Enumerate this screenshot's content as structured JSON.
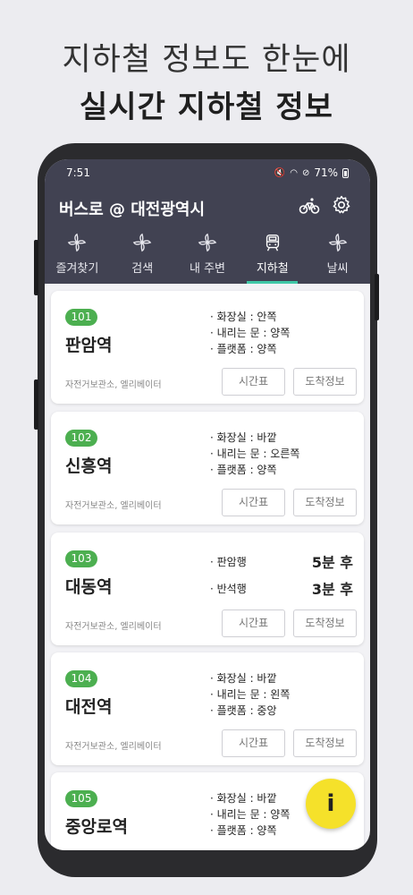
{
  "promo": {
    "line1": "지하철 정보도 한눈에",
    "line2": "실시간 지하철 정보"
  },
  "status_bar": {
    "time": "7:51",
    "battery": "71%"
  },
  "app": {
    "title": "버스로 @ 대전광역시"
  },
  "tabs": [
    {
      "label": "즐겨찾기",
      "icon": "pinwheel-icon"
    },
    {
      "label": "검색",
      "icon": "pinwheel-icon"
    },
    {
      "label": "내 주변",
      "icon": "pinwheel-icon"
    },
    {
      "label": "지하철",
      "icon": "train-icon",
      "active": true
    },
    {
      "label": "날씨",
      "icon": "pinwheel-icon"
    }
  ],
  "colors": {
    "header": "#414252",
    "active_tab_indicator": "#3fc7a6",
    "line_badge": "#4caf50",
    "fab": "#f5e12a"
  },
  "stations": [
    {
      "number": "101",
      "name": "판암역",
      "facilities": "자전거보관소, 엘리베이터",
      "info": [
        "· 화장실 : 안쪽",
        "· 내리는 문 : 양쪽",
        "· 플랫폼 : 양쪽"
      ]
    },
    {
      "number": "102",
      "name": "신흥역",
      "facilities": "자전거보관소, 엘리베이터",
      "info": [
        "· 화장실 : 바깥",
        "· 내리는 문 : 오른쪽",
        "· 플랫폼 : 양쪽"
      ]
    },
    {
      "number": "103",
      "name": "대동역",
      "facilities": "자전거보관소, 엘리베이터",
      "arrivals": [
        {
          "direction": "· 판암행",
          "time": "5분 후"
        },
        {
          "direction": "· 반석행",
          "time": "3분 후"
        }
      ]
    },
    {
      "number": "104",
      "name": "대전역",
      "facilities": "자전거보관소, 엘리베이터",
      "info": [
        "· 화장실 : 바깥",
        "· 내리는 문 : 왼쪽",
        "· 플랫폼 : 중앙"
      ]
    },
    {
      "number": "105",
      "name": "중앙로역",
      "info": [
        "· 화장실 : 바깥",
        "· 내리는 문 : 양쪽",
        "· 플랫폼 : 양쪽"
      ]
    }
  ],
  "buttons": {
    "timetable": "시간표",
    "arrival": "도착정보"
  },
  "fab": {
    "label": "i"
  }
}
